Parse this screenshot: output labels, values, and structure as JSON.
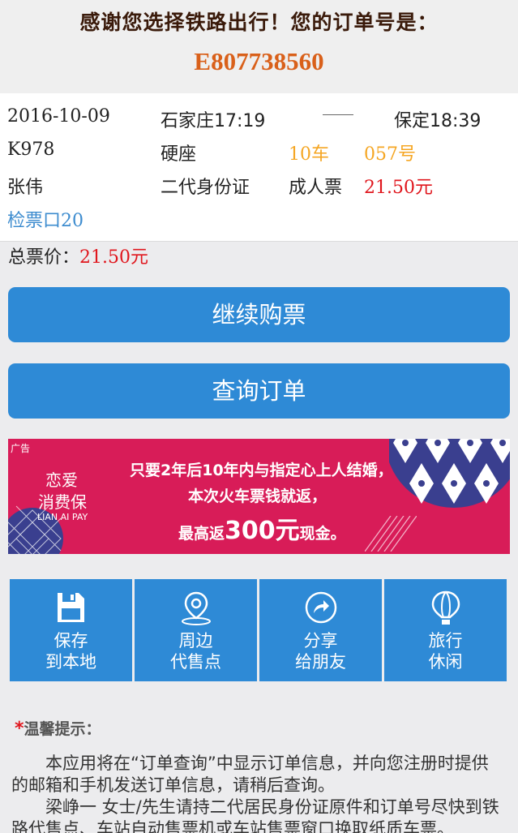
{
  "header": {
    "thanks": "感谢您选择铁路出行！您的订单号是：",
    "order_number": "E807738560"
  },
  "ticket": {
    "date": "2016-10-09",
    "from": "石家庄17:19",
    "to": "保定18:39",
    "train": "K978",
    "seat_class": "硬座",
    "car": "10车",
    "seat_no": "057号",
    "passenger": "张伟",
    "id_type": "二代身份证",
    "ticket_type": "成人票",
    "price": "21.50元",
    "gate": "检票口20"
  },
  "total": {
    "label": "总票价：",
    "value": "21.50元"
  },
  "buttons": {
    "continue": "继续购票",
    "query": "查询订单"
  },
  "ad": {
    "tag": "广告",
    "brand_line1": "恋爱",
    "brand_line2": "消费保",
    "brand_en": "LIAN AI PAY",
    "line1": "只要2年后10年内与指定心上人结婚，",
    "line2": "本次火车票钱就返，",
    "line3_a": "最高返",
    "line3_big": "300元",
    "line3_b": "现金。"
  },
  "tiles": [
    {
      "icon": "save-icon",
      "line1": "保存",
      "line2": "到本地"
    },
    {
      "icon": "location-pin-icon",
      "line1": "周边",
      "line2": "代售点"
    },
    {
      "icon": "share-icon",
      "line1": "分享",
      "line2": "给朋友"
    },
    {
      "icon": "balloon-icon",
      "line1": "旅行",
      "line2": "休闲"
    }
  ],
  "tips": {
    "star": "*",
    "title": "温馨提示：",
    "para1": "本应用将在“订单查询”中显示订单信息，并向您注册时提供的邮箱和手机发送订单信息，请稍后查询。",
    "para2": "梁峥一 女士/先生请持二代居民身份证原件和订单号尽快到铁路代售点、车站自动售票机或车站售票窗口换取纸质车票。"
  },
  "colors": {
    "accent_blue": "#2e8ad6",
    "order_orange": "#d9601a",
    "price_red": "#e0161d",
    "seat_yellow": "#f5a623",
    "ad_pink": "#d81c58"
  }
}
